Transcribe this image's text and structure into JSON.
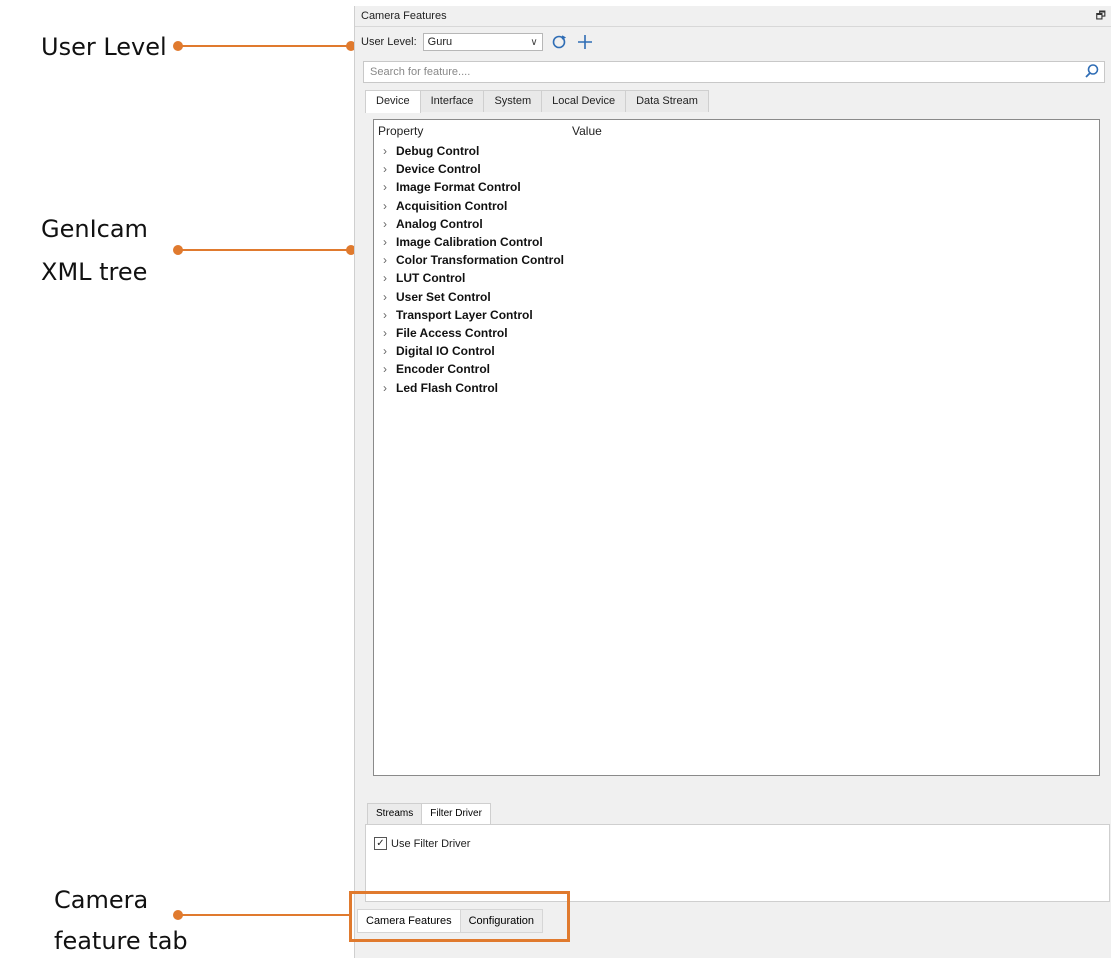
{
  "annotations": {
    "user_level": "User Level",
    "genicam_line1": "GenIcam",
    "genicam_line2": "XML tree",
    "camera_tab_line1": "Camera",
    "camera_tab_line2": "feature tab"
  },
  "panel": {
    "title": "Camera Features",
    "user_level_label": "User Level:",
    "user_level_value": "Guru",
    "search_placeholder": "Search for feature....",
    "tabs": [
      "Device",
      "Interface",
      "System",
      "Local Device",
      "Data Stream"
    ],
    "tree_header": {
      "property": "Property",
      "value": "Value"
    },
    "tree_items": [
      "Debug Control",
      "Device Control",
      "Image Format Control",
      "Acquisition Control",
      "Analog Control",
      "Image Calibration Control",
      "Color Transformation Control",
      "LUT Control",
      "User Set Control",
      "Transport Layer Control",
      "File Access Control",
      "Digital IO Control",
      "Encoder Control",
      "Led Flash Control"
    ],
    "subtabs": [
      "Streams",
      "Filter Driver"
    ],
    "use_filter_driver": "Use Filter Driver",
    "bottom_tabs": [
      "Camera Features",
      "Configuration"
    ]
  },
  "colors": {
    "accent": "#e07a2e"
  },
  "icons": [
    "pin-icon",
    "chevron-down-icon",
    "refresh-icon",
    "plus-icon",
    "search-icon",
    "chevron-right-icon",
    "checkbox-checked-icon"
  ]
}
